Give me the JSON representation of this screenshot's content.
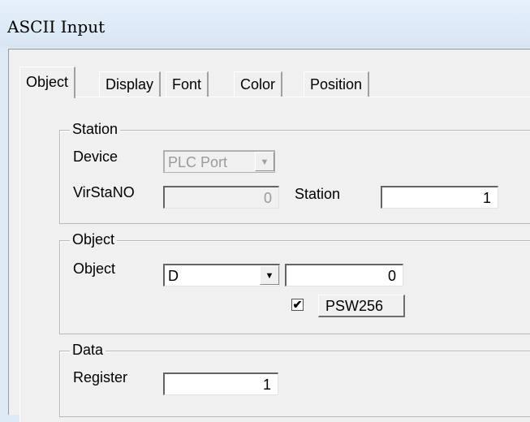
{
  "window": {
    "title": "ASCII Input"
  },
  "tabs": [
    {
      "label": "Object"
    },
    {
      "label": "Display"
    },
    {
      "label": "Font"
    },
    {
      "label": "Color"
    },
    {
      "label": "Position"
    }
  ],
  "station_group": {
    "legend": "Station",
    "device_label": "Device",
    "device_value": "PLC Port",
    "virstano_label": "VirStaNO",
    "virstano_value": "0",
    "station_label": "Station",
    "station_value": "1"
  },
  "object_group": {
    "legend": "Object",
    "object_label": "Object",
    "object_type": "D",
    "object_address": "0",
    "psw_checked": true,
    "psw_button": "PSW256"
  },
  "data_group": {
    "legend": "Data",
    "register_label": "Register",
    "register_value": "1"
  },
  "icons": {
    "dropdown": "chevron-down-icon",
    "check": "checkmark-icon"
  }
}
